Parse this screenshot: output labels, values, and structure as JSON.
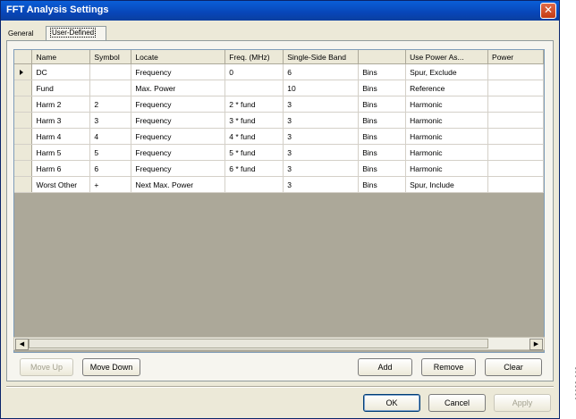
{
  "window": {
    "title": "FFT Analysis Settings"
  },
  "tabs": [
    {
      "label": "General"
    },
    {
      "label": "User-Defined"
    }
  ],
  "table": {
    "columns": [
      "Name",
      "Symbol",
      "Locate",
      "Freq. (MHz)",
      "Single-Side Band",
      "",
      "Use Power As...",
      "Power"
    ],
    "rows": [
      [
        "DC",
        "",
        "Frequency",
        "0",
        "6",
        "Bins",
        "Spur, Exclude",
        ""
      ],
      [
        "Fund",
        "",
        "Max. Power",
        "",
        "10",
        "Bins",
        "Reference",
        ""
      ],
      [
        "Harm 2",
        "2",
        "Frequency",
        "2 * fund",
        "3",
        "Bins",
        "Harmonic",
        ""
      ],
      [
        "Harm 3",
        "3",
        "Frequency",
        "3 * fund",
        "3",
        "Bins",
        "Harmonic",
        ""
      ],
      [
        "Harm 4",
        "4",
        "Frequency",
        "4 * fund",
        "3",
        "Bins",
        "Harmonic",
        ""
      ],
      [
        "Harm 5",
        "5",
        "Frequency",
        "5 * fund",
        "3",
        "Bins",
        "Harmonic",
        ""
      ],
      [
        "Harm 6",
        "6",
        "Frequency",
        "6 * fund",
        "3",
        "Bins",
        "Harmonic",
        ""
      ],
      [
        "Worst Other",
        "+",
        "Next Max. Power",
        "",
        "3",
        "Bins",
        "Spur, Include",
        ""
      ]
    ]
  },
  "grid_buttons": {
    "move_up": "Move Up",
    "move_down": "Move Down",
    "add": "Add",
    "remove": "Remove",
    "clear": "Clear"
  },
  "dialog_buttons": {
    "ok": "OK",
    "cancel": "Cancel",
    "apply": "Apply"
  },
  "scroll_arrows": {
    "left": "◀",
    "right": "▶"
  },
  "close_glyph": "✕",
  "figure_number": "06683-062"
}
